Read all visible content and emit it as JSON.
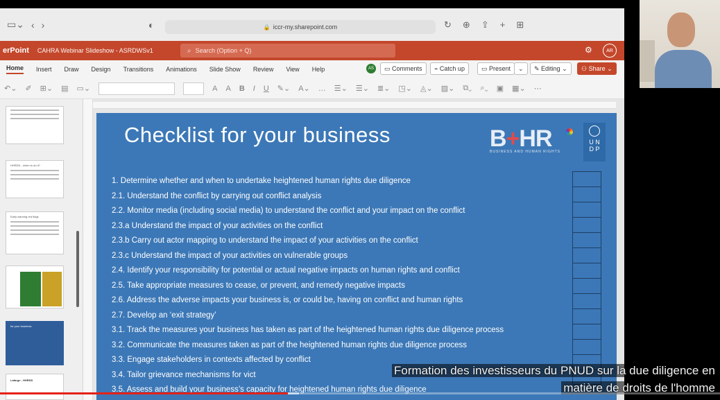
{
  "browser": {
    "url": "iccr-my.sharepoint.com"
  },
  "ppt": {
    "app_name": "erPoint",
    "doc_title": "CAHRA Webinar Slideshow - ASRDWSv1",
    "search_placeholder": "Search (Option + Q)",
    "avatar_initials": "AR",
    "tabs": [
      "Home",
      "Insert",
      "Draw",
      "Design",
      "Transitions",
      "Animations",
      "Slide Show",
      "Review",
      "View",
      "Help"
    ],
    "active_tab": "Home",
    "presence_initials": "AS",
    "buttons": {
      "comments": "Comments",
      "catch_up": "Catch up",
      "present": "Present",
      "editing": "Editing",
      "share": "Share"
    }
  },
  "slide": {
    "title": "Checklist for your business",
    "logo_text": "B+HR",
    "logo_subtitle": "BUSINESS AND HUMAN RIGHTS",
    "undp_line1": "U N",
    "undp_line2": "D P",
    "items": [
      "1. Determine whether and when to undertake heightened human rights due diligence",
      "2.1. Understand the conflict by carrying out conflict analysis",
      "2.2. Monitor media (including social media) to understand the conflict and your impact on the conflict",
      "2.3.a Understand the impact of your activities on the conflict",
      "2.3.b Carry out actor mapping to understand the impact of your activities on the conflict",
      "2.3.c Understand the impact of your activities on vulnerable groups",
      "2.4. Identify your responsibility for potential or actual negative impacts on human rights and conflict",
      "2.5. Take appropriate measures to cease, or prevent, and remedy negative impacts",
      "2.6. Address the adverse impacts your business is, or could be, having on conflict and human rights",
      "2.7. Develop an ‘exit strategy’",
      "3.1. Track the measures your business has taken as part of the heightened human rights due diligence process",
      "3.2. Communicate the measures taken as part of the heightened human rights due diligence process",
      "3.3. Engage stakeholders in contexts affected by conflict",
      "3.4. Tailor grievance mechanisms for vict",
      "3.5. Assess and build your business’s capacity for heightened human rights due diligence"
    ],
    "checkbox_count": 14
  },
  "thumbnails": {
    "t2_title": "HHRDD - when to do it?",
    "t3_title": "Early warning red flags",
    "t5_title": "for your business",
    "t6_title": "Lafarge - HHRDD"
  },
  "video": {
    "subtitle_line1": "Formation des investisseurs du PNUD sur la due diligence en",
    "subtitle_line2": "matière de droits de l'homme",
    "progress": 0.4,
    "buffered": 0.415
  },
  "colors": {
    "ppt_accent": "#c4472b",
    "slide_bg": "#3c78b7",
    "progress_red": "#e62117"
  }
}
